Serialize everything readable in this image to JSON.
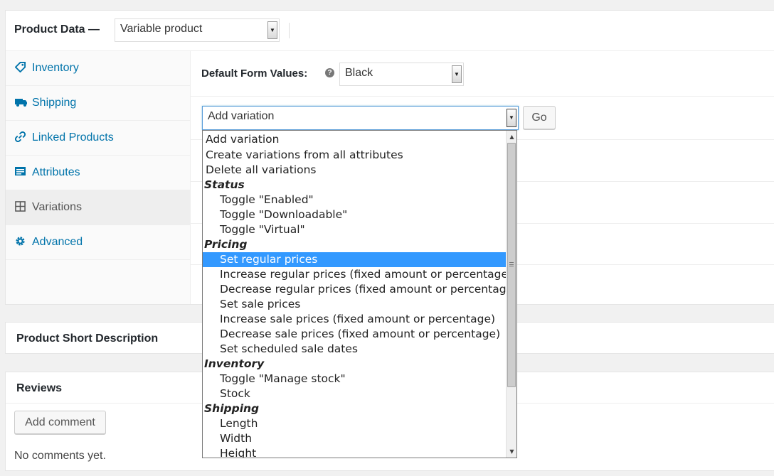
{
  "product_data": {
    "title": "Product Data —",
    "product_type": "Variable product"
  },
  "tabs": [
    {
      "label": "Inventory",
      "icon": "tag-icon"
    },
    {
      "label": "Shipping",
      "icon": "truck-icon"
    },
    {
      "label": "Linked Products",
      "icon": "link-icon"
    },
    {
      "label": "Attributes",
      "icon": "list-icon"
    },
    {
      "label": "Variations",
      "icon": "grid-icon",
      "active": true
    },
    {
      "label": "Advanced",
      "icon": "gear-icon"
    }
  ],
  "variations": {
    "default_form_label": "Default Form Values:",
    "help_icon": "?",
    "default_value": "Black",
    "bulk_selected": "Add variation",
    "go_label": "Go"
  },
  "dropdown": {
    "options": [
      {
        "text": "Add variation",
        "kind": "option"
      },
      {
        "text": "Create variations from all attributes",
        "kind": "option"
      },
      {
        "text": "Delete all variations",
        "kind": "option"
      },
      {
        "text": "Status",
        "kind": "group"
      },
      {
        "text": "Toggle \"Enabled\"",
        "kind": "sub"
      },
      {
        "text": "Toggle \"Downloadable\"",
        "kind": "sub"
      },
      {
        "text": "Toggle \"Virtual\"",
        "kind": "sub"
      },
      {
        "text": "Pricing",
        "kind": "group"
      },
      {
        "text": "Set regular prices",
        "kind": "sub",
        "selected": true
      },
      {
        "text": "Increase regular prices (fixed amount or percentage)",
        "kind": "sub"
      },
      {
        "text": "Decrease regular prices (fixed amount or percentage)",
        "kind": "sub"
      },
      {
        "text": "Set sale prices",
        "kind": "sub"
      },
      {
        "text": "Increase sale prices (fixed amount or percentage)",
        "kind": "sub"
      },
      {
        "text": "Decrease sale prices (fixed amount or percentage)",
        "kind": "sub"
      },
      {
        "text": "Set scheduled sale dates",
        "kind": "sub"
      },
      {
        "text": "Inventory",
        "kind": "group"
      },
      {
        "text": "Toggle \"Manage stock\"",
        "kind": "sub"
      },
      {
        "text": "Stock",
        "kind": "sub"
      },
      {
        "text": "Shipping",
        "kind": "group"
      },
      {
        "text": "Length",
        "kind": "sub"
      },
      {
        "text": "Width",
        "kind": "sub"
      },
      {
        "text": "Height",
        "kind": "sub"
      }
    ]
  },
  "short_description": {
    "title": "Product Short Description"
  },
  "reviews": {
    "title": "Reviews",
    "add_comment_label": "Add comment",
    "empty_text": "No comments yet."
  }
}
